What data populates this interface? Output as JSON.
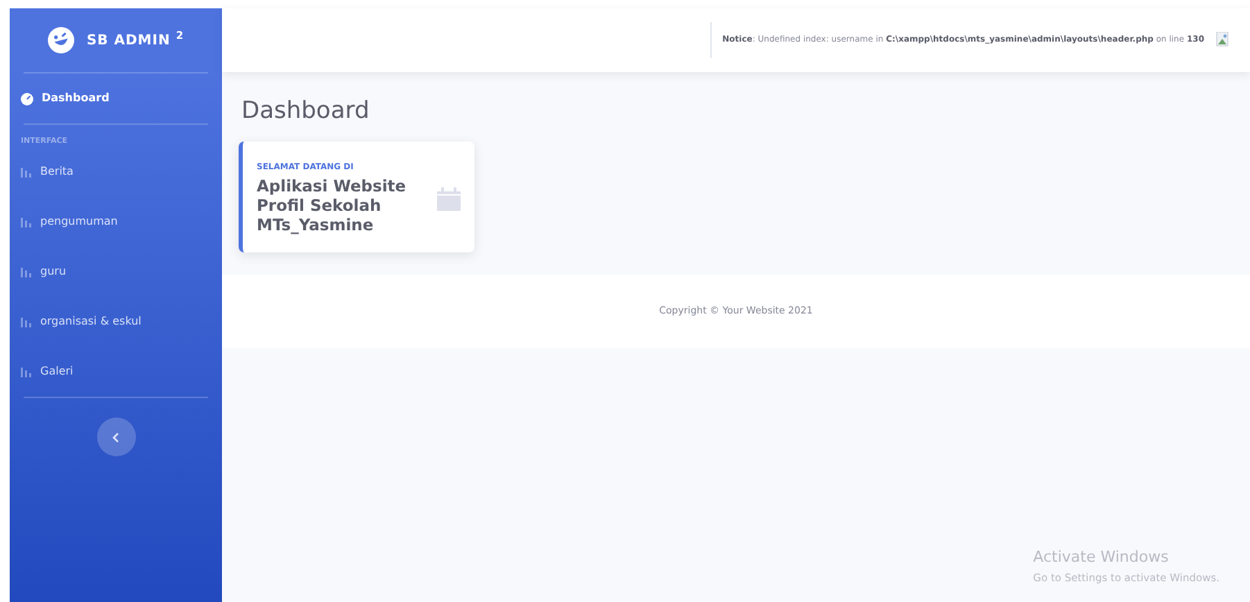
{
  "sidebar": {
    "brand": "SB ADMIN",
    "brand_sup": "2",
    "items": [
      {
        "label": "Dashboard",
        "kind": "dashboard",
        "selected": true
      }
    ],
    "heading": "INTERFACE",
    "menu": [
      {
        "label": "Berita",
        "selected": false
      },
      {
        "label": "pengumuman",
        "selected": false
      },
      {
        "label": "guru",
        "selected": false
      },
      {
        "label": "organisasi & eskul",
        "selected": false
      },
      {
        "label": "Galeri",
        "selected": false
      }
    ]
  },
  "topbar": {
    "notice": "**Notice**: Undefined index: username in **C:\\xampp\\htdocs\\mts_yasmine\\admin\\layouts\\header.php** on line **130**"
  },
  "page": {
    "title": "Dashboard",
    "card": {
      "subtitle": "SELAMAT DATANG DI",
      "text": "Aplikasi Website Profil Sekolah MTs_Yasmine"
    }
  },
  "footer": {
    "copyright": "Copyright © Your Website 2021"
  },
  "os_notice": {
    "title": "Activate Windows",
    "text": "Go to Settings to activate Windows."
  }
}
